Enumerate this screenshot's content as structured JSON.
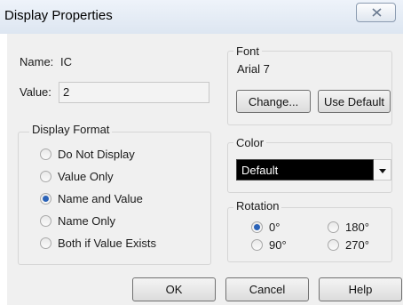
{
  "window": {
    "title": "Display Properties"
  },
  "name_row": {
    "label": "Name:",
    "value": "IC"
  },
  "value_row": {
    "label": "Value:",
    "value": "2"
  },
  "display_format": {
    "title": "Display Format",
    "options": [
      "Do Not Display",
      "Value Only",
      "Name and Value",
      "Name Only",
      "Both if Value Exists"
    ],
    "selected": "Name and Value"
  },
  "font": {
    "title": "Font",
    "current": "Arial 7",
    "change_label": "Change...",
    "default_label": "Use Default"
  },
  "color": {
    "title": "Color",
    "selected": "Default"
  },
  "rotation": {
    "title": "Rotation",
    "options": [
      "0°",
      "180°",
      "90°",
      "270°"
    ],
    "selected": "0°"
  },
  "buttons": {
    "ok": "OK",
    "cancel": "Cancel",
    "help": "Help"
  }
}
